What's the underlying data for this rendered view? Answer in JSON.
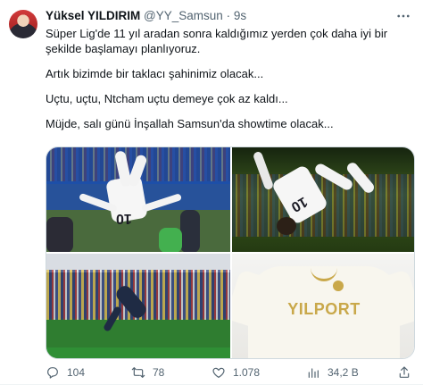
{
  "tweet": {
    "author_name": "Yüksel YILDIRIM",
    "handle": "@YY_Samsun",
    "separator": "·",
    "time": "9s",
    "paragraphs": [
      "Süper Lig'de 11 yıl aradan sonra kaldığımız yerden çok daha iyi bir şekilde başlamayı planlıyoruz.",
      "Artık bizimde bir taklacı şahinimiz olacak...",
      "Uçtu, uçtu, Ntcham uçtu demeye çok az kaldı...",
      "Müjde, salı günü İnşallah Samsun'da showtime olacak..."
    ],
    "jersey_brand": "YILPORT",
    "jersey_numbers": [
      "10",
      "10"
    ]
  },
  "actions": {
    "reply_count": "104",
    "retweet_count": "78",
    "like_count": "1.078",
    "views_count": "34,2 B"
  },
  "icons": [
    "more-icon",
    "reply-icon",
    "retweet-icon",
    "like-icon",
    "views-icon",
    "share-icon"
  ],
  "colors": {
    "text": "#0f1419",
    "muted": "#536471",
    "border": "#cfd9de",
    "gold": "#c9a84a"
  }
}
